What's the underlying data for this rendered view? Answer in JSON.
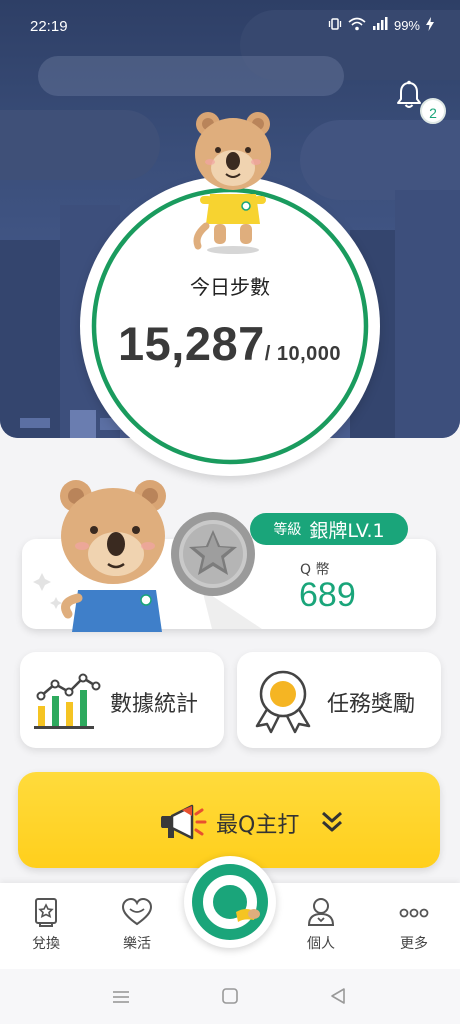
{
  "status_bar": {
    "time": "22:19",
    "battery": "99%"
  },
  "notifications": {
    "count": "2"
  },
  "steps": {
    "title": "今日步數",
    "count": "15,287",
    "goal": "/ 10,000"
  },
  "level": {
    "prefix": "等級",
    "name": "銀牌LV.1"
  },
  "coins": {
    "label": "Q 幣",
    "value": "689"
  },
  "features": [
    {
      "label": "數據統計",
      "icon": "bar-chart-icon"
    },
    {
      "label": "任務獎勵",
      "icon": "medal-ribbon-icon"
    }
  ],
  "promo": {
    "label": "最Q主打",
    "icon": "megaphone-icon"
  },
  "bottom_nav": [
    {
      "label": "兌換",
      "icon": "redeem-icon"
    },
    {
      "label": "樂活",
      "icon": "heart-icon"
    },
    {
      "label": "",
      "icon": "q-center-icon"
    },
    {
      "label": "個人",
      "icon": "person-icon"
    },
    {
      "label": "更多",
      "icon": "more-dots-icon"
    }
  ],
  "colors": {
    "accent": "#1aa57a",
    "promo": "#ffd42a",
    "hero_sky": "#3a4e7a"
  }
}
